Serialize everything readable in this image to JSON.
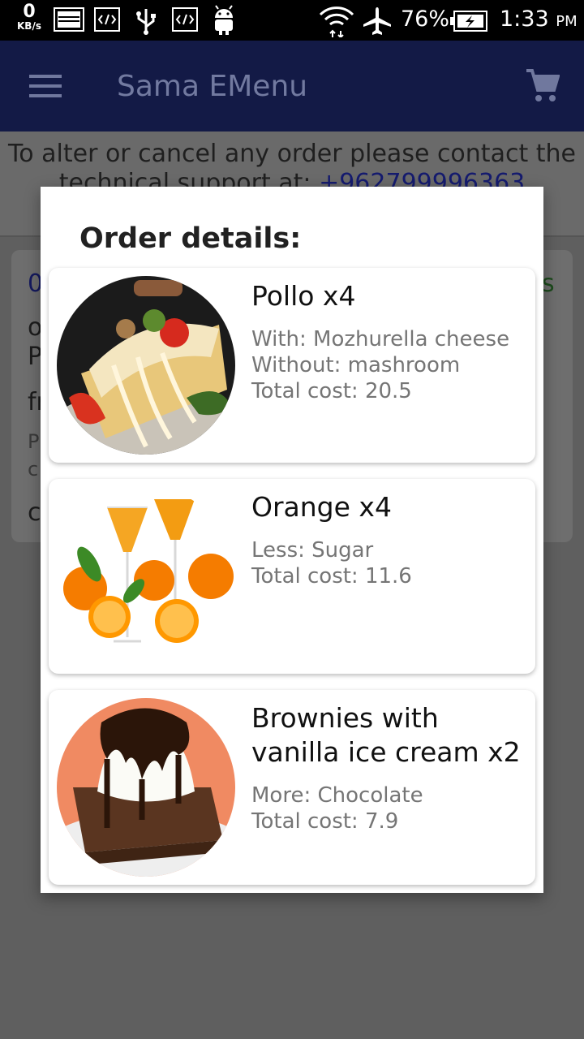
{
  "status_bar": {
    "net_speed": "0",
    "net_unit": "KB/s",
    "battery": "76%",
    "time": "1:33",
    "ampm": "PM",
    "icons": [
      "image-icon",
      "code-icon",
      "usb-icon",
      "code-icon",
      "android-icon",
      "wifi-icon",
      "airplane-icon",
      "battery-charging-icon"
    ]
  },
  "app_bar": {
    "title": "Sama EMenu",
    "menu_icon": "hamburger-menu-icon",
    "cart_icon": "shopping-cart-icon",
    "color": "#131a46"
  },
  "background": {
    "notice_line1": "To alter or cancel any order please contact the",
    "notice_line2": "technical support at: ",
    "notice_phone": "+962799996363",
    "card_fragments": [
      "0",
      "o",
      "P",
      "fr",
      "P",
      "c",
      "c",
      "s"
    ]
  },
  "dialog": {
    "heading": "Order details:",
    "items": [
      {
        "name": "Pollo x4",
        "details": [
          "With: Mozhurella cheese",
          "Without: mashroom",
          "Total cost: 20.5"
        ],
        "image": "pizza-image"
      },
      {
        "name": "Orange x4",
        "details": [
          "Less: Sugar",
          "Total cost: 11.6"
        ],
        "image": "orange-juice-image"
      },
      {
        "name": "Brownies with vanilla ice cream x2",
        "details": [
          "More: Chocolate",
          "Total cost: 7.9"
        ],
        "image": "brownie-image"
      }
    ]
  }
}
